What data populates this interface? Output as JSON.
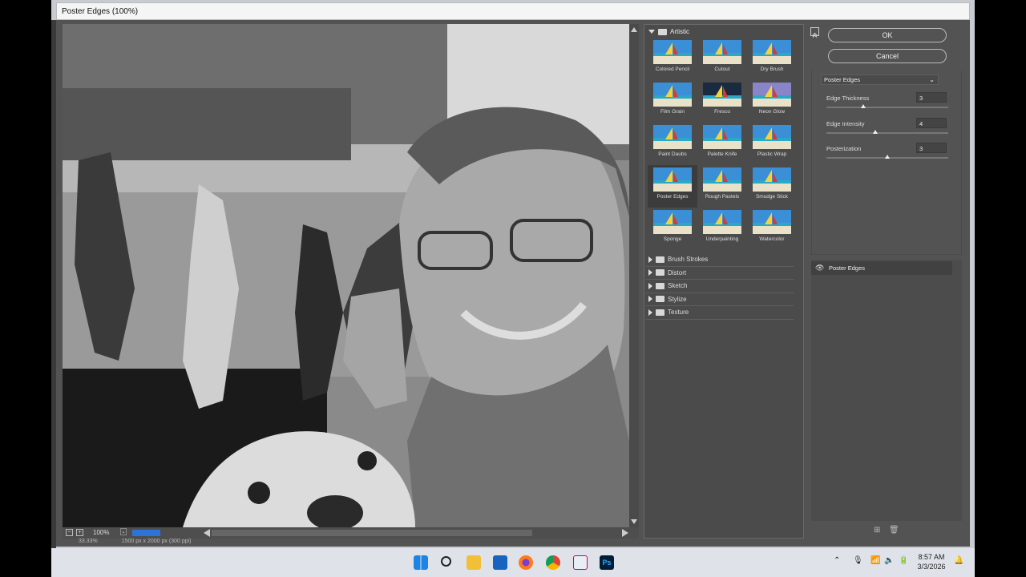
{
  "window": {
    "title": "Poster Edges (100%)"
  },
  "dialog": {
    "ok_label": "OK",
    "cancel_label": "Cancel"
  },
  "preview": {
    "zoom": "100%",
    "zoom_minus": "−",
    "zoom_plus": "+",
    "status_zoom": "33.33%",
    "status_info": "1500 px x 2000 px (300 ppi)"
  },
  "gallery": {
    "open_category": "Artistic",
    "filters": [
      {
        "label": "Colored Pencil"
      },
      {
        "label": "Cutout"
      },
      {
        "label": "Dry Brush"
      },
      {
        "label": "Film Grain"
      },
      {
        "label": "Fresco"
      },
      {
        "label": "Neon Glow"
      },
      {
        "label": "Paint Daubs"
      },
      {
        "label": "Palette Knife"
      },
      {
        "label": "Plastic Wrap"
      },
      {
        "label": "Poster Edges"
      },
      {
        "label": "Rough Pastels"
      },
      {
        "label": "Smudge Stick"
      },
      {
        "label": "Sponge"
      },
      {
        "label": "Underpainting"
      },
      {
        "label": "Watercolor"
      }
    ],
    "selected": "Poster Edges",
    "categories": [
      "Brush Strokes",
      "Distort",
      "Sketch",
      "Stylize",
      "Texture"
    ]
  },
  "settings": {
    "filter": "Poster Edges",
    "params": [
      {
        "label": "Edge Thickness",
        "value": "3",
        "fraction": 0.3
      },
      {
        "label": "Edge Intensity",
        "value": "4",
        "fraction": 0.4
      },
      {
        "label": "Posterization",
        "value": "3",
        "fraction": 0.5
      }
    ]
  },
  "layers": {
    "items": [
      "Poster Edges"
    ]
  },
  "taskbar": {
    "time": "8:57 AM",
    "date": "3/3/2026"
  },
  "colors": {
    "accent": "#2d74da",
    "dialog_bg": "#535353",
    "panel_bg": "#4b4b4b"
  }
}
